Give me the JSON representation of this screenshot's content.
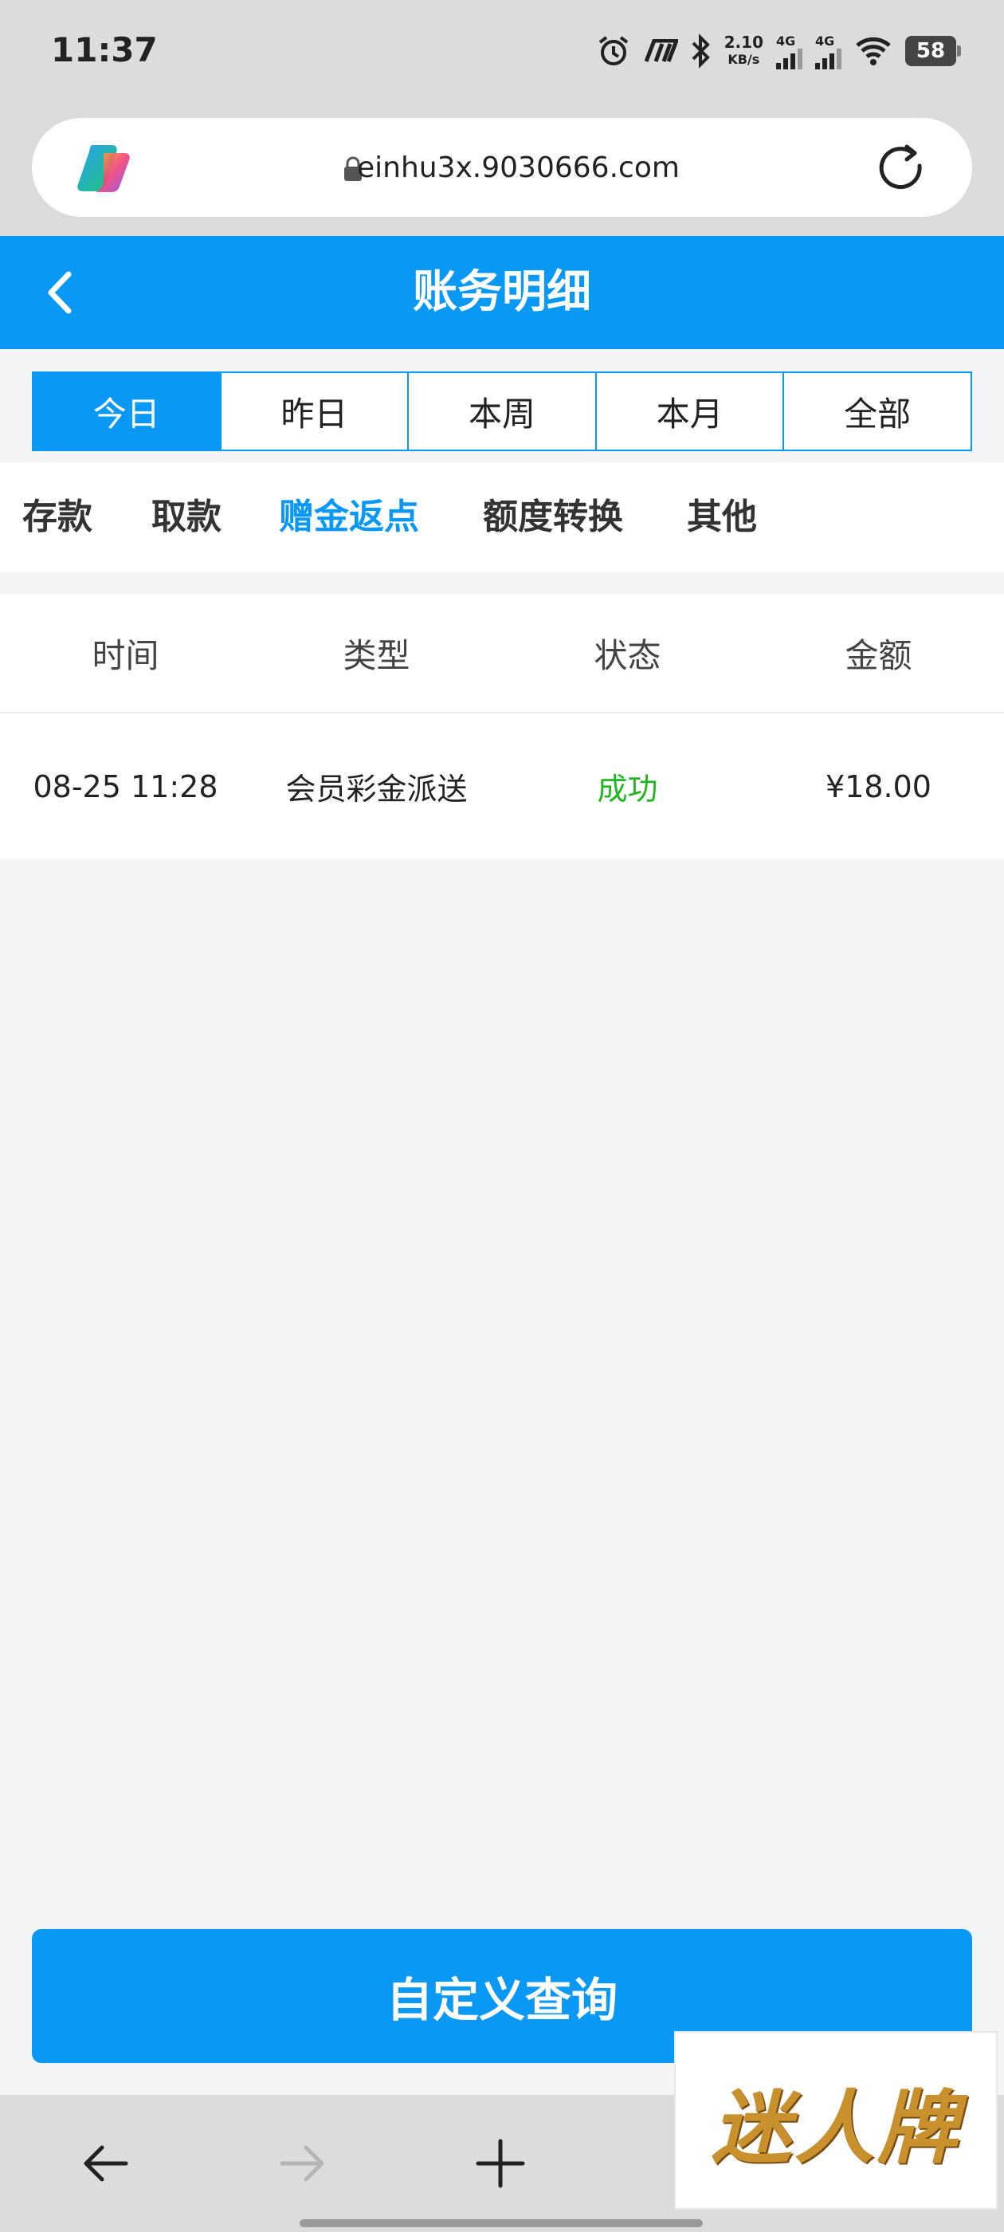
{
  "status_bar": {
    "time": "11:37",
    "net_speed_value": "2.10",
    "net_speed_unit": "KB/s",
    "network1": "4G",
    "network2": "4G",
    "battery": "58"
  },
  "browser": {
    "url": "einhu3x.9030666.com"
  },
  "header": {
    "title": "账务明细"
  },
  "date_tabs": [
    {
      "label": "今日",
      "active": true
    },
    {
      "label": "昨日",
      "active": false
    },
    {
      "label": "本周",
      "active": false
    },
    {
      "label": "本月",
      "active": false
    },
    {
      "label": "全部",
      "active": false
    }
  ],
  "category_tabs": [
    {
      "label": "存款",
      "active": false
    },
    {
      "label": "取款",
      "active": false
    },
    {
      "label": "赠金返点",
      "active": true
    },
    {
      "label": "额度转换",
      "active": false
    },
    {
      "label": "其他",
      "active": false
    }
  ],
  "table": {
    "columns": [
      "时间",
      "类型",
      "状态",
      "金额"
    ],
    "rows": [
      {
        "time": "08-25 11:28",
        "type": "会员彩金派送",
        "status": "成功",
        "amount": "¥18.00"
      }
    ]
  },
  "query_button": {
    "label": "自定义查询"
  },
  "watermark": {
    "text": "迷人牌"
  },
  "colors": {
    "accent": "#0a98f5",
    "success": "#22b522"
  }
}
